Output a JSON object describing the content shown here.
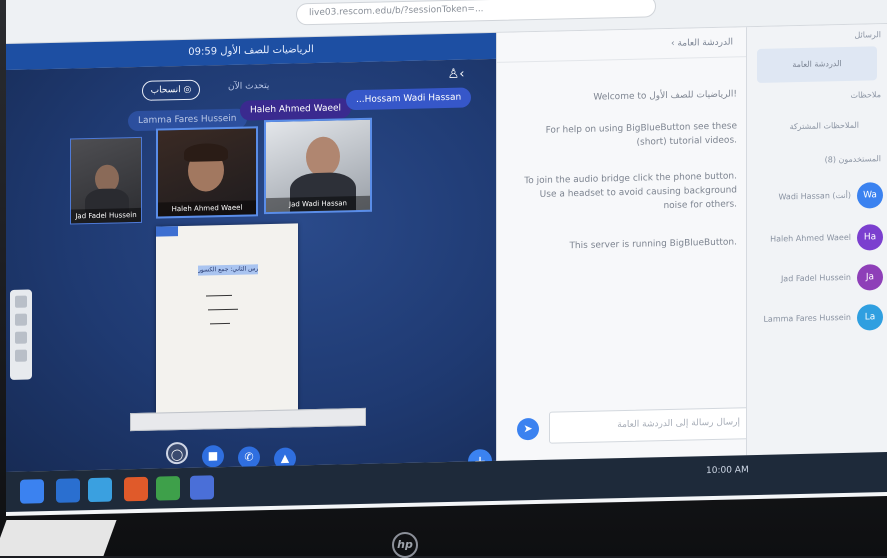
{
  "browser": {
    "url": "live03.rescom.edu/b/?sessionToken=..."
  },
  "meeting": {
    "title": "الرياضيات للصف الأول 09:59"
  },
  "header": {
    "exit_label": "انسحاب ◎",
    "presenter_label": "يتحدث الآن"
  },
  "talkers": [
    {
      "name": "Lamma Fares Hussein"
    },
    {
      "name": "Haleh Ahmed Waeel"
    },
    {
      "name": "...Hossam Wadi Hassan"
    }
  ],
  "cameras": [
    {
      "name": "Jad Fadel Hussein"
    },
    {
      "name": "Haleh Ahmed Waeel"
    },
    {
      "name": "Jad Wadi Hassan"
    }
  ],
  "presentation": {
    "highlight": "الدرس الثاني: جمع الكسور"
  },
  "chat": {
    "header": "‹ الدردشة العامة",
    "messages": [
      {
        "text": "Welcome to الرياضيات للصف الأول!"
      },
      {
        "text": "For help on using BigBlueButton see these (short) tutorial videos."
      },
      {
        "text": "To join the audio bridge click the phone button. Use a headset to avoid causing background noise for others."
      },
      {
        "text": "This server is running BigBlueButton."
      }
    ],
    "input_placeholder": "إرسال رسالة إلى الدردشة العامة"
  },
  "users_panel": {
    "messages_heading": "الرسائل",
    "public_chat": "الدردشة العامة",
    "notes_heading": "ملاحظات",
    "shared_notes": "الملاحظات المشتركة",
    "users_heading": "المستخدمون (8)",
    "users": [
      {
        "name": "Wadi Hassan (أنت)",
        "initials": "Wa",
        "color": "#3b82f0"
      },
      {
        "name": "Haleh Ahmed Waeel",
        "initials": "Ha",
        "color": "#7b3fcf"
      },
      {
        "name": "Jad Fadel Hussein",
        "initials": "Ja",
        "color": "#8e3fb8"
      },
      {
        "name": "Lamma Fares Hussein",
        "initials": "La",
        "color": "#2f9fe0"
      }
    ]
  },
  "taskbar": {
    "clock": "10:00 AM"
  },
  "brand": {
    "logo": "hp"
  },
  "colors": {
    "accent": "#1d4fa3",
    "primary": "#3b82f0"
  }
}
